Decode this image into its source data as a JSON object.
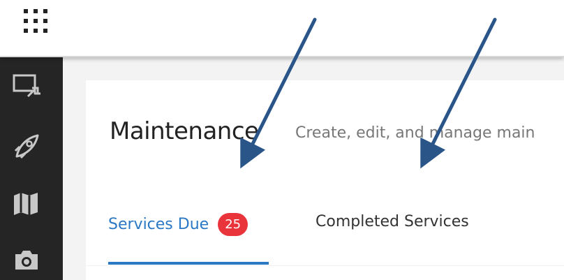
{
  "header": {
    "app_launcher_icon": "app-launcher-grid-icon"
  },
  "sidebar": {
    "items": [
      {
        "icon": "screen-share-icon"
      },
      {
        "icon": "rocket-icon"
      },
      {
        "icon": "map-icon"
      },
      {
        "icon": "camera-icon"
      }
    ]
  },
  "page": {
    "title": "Maintenance",
    "subtitle": "Create, edit, and manage main"
  },
  "tabs": [
    {
      "label": "Services Due",
      "badge": "25",
      "active": true
    },
    {
      "label": "Completed Services",
      "active": false
    }
  ],
  "colors": {
    "accent": "#2b78c5",
    "badge": "#e8343a",
    "sidebar": "#252525",
    "annotation_arrow": "#2a5589"
  }
}
